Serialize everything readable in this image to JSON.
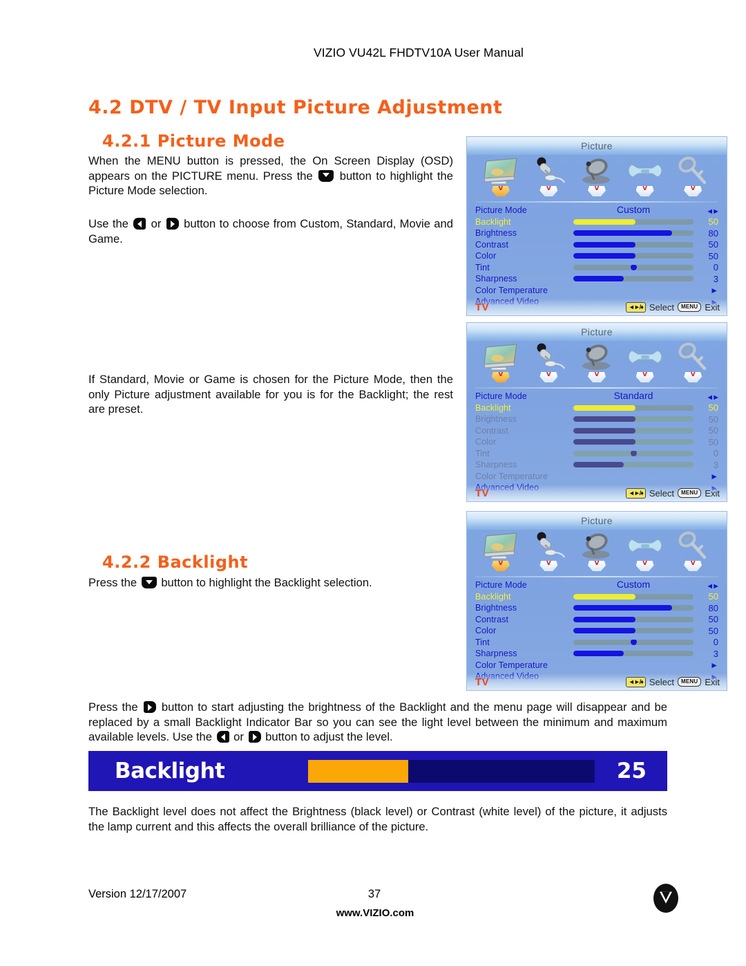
{
  "header": {
    "title": "VIZIO VU42L FHDTV10A User Manual"
  },
  "sections": {
    "h1": "4.2 DTV / TV Input Picture Adjustment",
    "h2_picture_mode": "4.2.1 Picture Mode",
    "h2_backlight": "4.2.2 Backlight"
  },
  "paragraphs": {
    "p1_a": "When the MENU button is pressed, the On Screen Display (OSD) appears on the PICTURE menu.  Press the ",
    "p1_b": " button to highlight the Picture Mode selection.",
    "p2_a": "Use the ",
    "p2_b": " or ",
    "p2_c": " button to choose from Custom, Standard, Movie and Game.",
    "p3": "If Standard, Movie or Game is chosen for the Picture Mode, then the only Picture adjustment available for you is for the Backlight; the rest are preset.",
    "p4_a": "Press the ",
    "p4_b": " button to highlight the Backlight selection.",
    "p5_a": " Press the ",
    "p5_b": " button to start adjusting the brightness of the Backlight and the menu page will disappear and be replaced by a small Backlight Indicator Bar so you can see the light level between the minimum and maximum available levels.  Use the ",
    "p5_c": " or ",
    "p5_d": " button to adjust the level.",
    "p6": "The Backlight level does not affect the Brightness (black level) or Contrast (white level) of the picture, it adjusts the lamp current and this affects the overall brilliance of the picture."
  },
  "osd_common": {
    "title": "Picture",
    "source_label": "TV",
    "select_label": "Select",
    "exit_label": "Exit",
    "pad_key": "◄►/♦",
    "menu_key": "MENU",
    "icons": [
      {
        "name": "picture-icon",
        "glyph": "monitor"
      },
      {
        "name": "audio-icon",
        "glyph": "microphone"
      },
      {
        "name": "tuner-icon",
        "glyph": "satellite-dish"
      },
      {
        "name": "setup-icon",
        "glyph": "wrench"
      },
      {
        "name": "parental-icon",
        "glyph": "key"
      }
    ]
  },
  "osd_menus": [
    {
      "id": "osd-picture-custom-1",
      "rows": [
        {
          "label": "Picture Mode",
          "type": "mode",
          "value": "Custom",
          "state": "normal",
          "right": "lr"
        },
        {
          "label": "Backlight",
          "type": "slider",
          "value": "50",
          "percent": 52,
          "state": "selected",
          "right": ""
        },
        {
          "label": "Brightness",
          "type": "slider",
          "value": "80",
          "percent": 82,
          "state": "normal",
          "right": ""
        },
        {
          "label": "Contrast",
          "type": "slider",
          "value": "50",
          "percent": 52,
          "state": "normal",
          "right": ""
        },
        {
          "label": "Color",
          "type": "slider",
          "value": "50",
          "percent": 52,
          "state": "normal",
          "right": ""
        },
        {
          "label": "Tint",
          "type": "knob",
          "value": "0",
          "percent": 50,
          "state": "normal",
          "right": ""
        },
        {
          "label": "Sharpness",
          "type": "slider",
          "value": "3",
          "percent": 42,
          "state": "normal",
          "right": ""
        },
        {
          "label": "Color Temperature",
          "type": "submenu",
          "value": "",
          "state": "normal",
          "right": "chev"
        },
        {
          "label": "Advanced Video",
          "type": "submenu",
          "value": "",
          "state": "normal",
          "right": "chev"
        }
      ]
    },
    {
      "id": "osd-picture-standard",
      "rows": [
        {
          "label": "Picture Mode",
          "type": "mode",
          "value": "Standard",
          "state": "normal",
          "right": "lr"
        },
        {
          "label": "Backlight",
          "type": "slider",
          "value": "50",
          "percent": 52,
          "state": "selected",
          "right": ""
        },
        {
          "label": "Brightness",
          "type": "slider",
          "value": "50",
          "percent": 52,
          "state": "disabled",
          "right": ""
        },
        {
          "label": "Contrast",
          "type": "slider",
          "value": "50",
          "percent": 52,
          "state": "disabled",
          "right": ""
        },
        {
          "label": "Color",
          "type": "slider",
          "value": "50",
          "percent": 52,
          "state": "disabled",
          "right": ""
        },
        {
          "label": "Tint",
          "type": "knob",
          "value": "0",
          "percent": 50,
          "state": "disabled",
          "right": ""
        },
        {
          "label": "Sharpness",
          "type": "slider",
          "value": "3",
          "percent": 42,
          "state": "disabled",
          "right": ""
        },
        {
          "label": "Color Temperature",
          "type": "submenu",
          "value": "",
          "state": "disabled",
          "right": "chev"
        },
        {
          "label": "Advanced Video",
          "type": "submenu",
          "value": "",
          "state": "normal",
          "right": "chev"
        }
      ]
    },
    {
      "id": "osd-picture-custom-2",
      "rows": [
        {
          "label": "Picture Mode",
          "type": "mode",
          "value": "Custom",
          "state": "normal",
          "right": "lr"
        },
        {
          "label": "Backlight",
          "type": "slider",
          "value": "50",
          "percent": 52,
          "state": "selected",
          "right": ""
        },
        {
          "label": "Brightness",
          "type": "slider",
          "value": "80",
          "percent": 82,
          "state": "normal",
          "right": ""
        },
        {
          "label": "Contrast",
          "type": "slider",
          "value": "50",
          "percent": 52,
          "state": "normal",
          "right": ""
        },
        {
          "label": "Color",
          "type": "slider",
          "value": "50",
          "percent": 52,
          "state": "normal",
          "right": ""
        },
        {
          "label": "Tint",
          "type": "knob",
          "value": "0",
          "percent": 50,
          "state": "normal",
          "right": ""
        },
        {
          "label": "Sharpness",
          "type": "slider",
          "value": "3",
          "percent": 42,
          "state": "normal",
          "right": ""
        },
        {
          "label": "Color Temperature",
          "type": "submenu",
          "value": "",
          "state": "normal",
          "right": "chev"
        },
        {
          "label": "Advanced Video",
          "type": "submenu",
          "value": "",
          "state": "normal",
          "right": "chev"
        }
      ]
    }
  ],
  "backlight_bar": {
    "label": "Backlight",
    "value": "25",
    "percent": 35,
    "bg_color": "#2015b5",
    "track_color": "#0d0a6e",
    "fill_color": "#FCA708"
  },
  "footer": {
    "version": "Version 12/17/2007",
    "page_number": "37",
    "website": "www.VIZIO.com"
  }
}
